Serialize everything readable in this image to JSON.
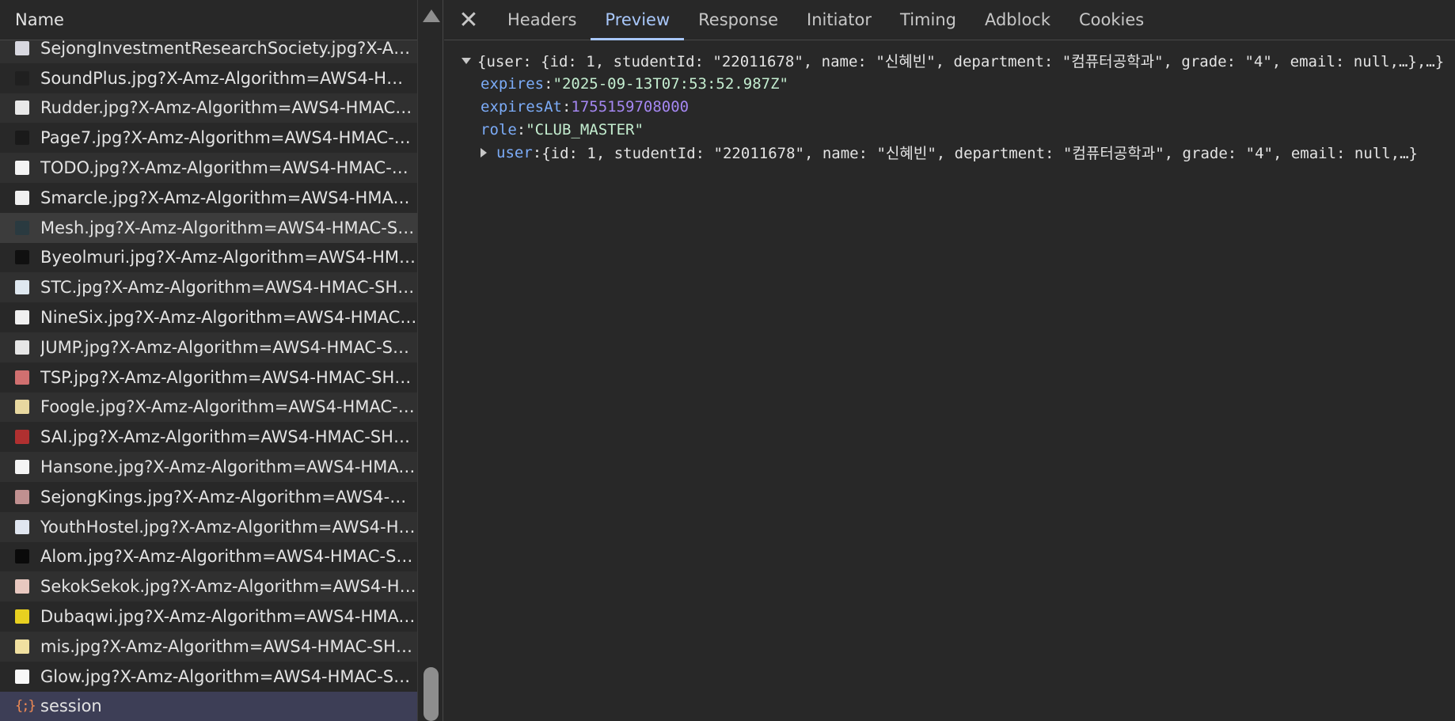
{
  "left_panel": {
    "header": "Name",
    "rows": [
      {
        "label": "SejongInvestmentResearchSociety.jpg?X-Amz-...",
        "thumb": "#d8d8e0",
        "state": "normal"
      },
      {
        "label": "SoundPlus.jpg?X-Amz-Algorithm=AWS4-HMA...",
        "thumb": "#202020",
        "state": "normal"
      },
      {
        "label": "Rudder.jpg?X-Amz-Algorithm=AWS4-HMAC-S...",
        "thumb": "#e8e8e8",
        "state": "normal"
      },
      {
        "label": "Page7.jpg?X-Amz-Algorithm=AWS4-HMAC-SH...",
        "thumb": "#1a1a1a",
        "state": "normal"
      },
      {
        "label": "TODO.jpg?X-Amz-Algorithm=AWS4-HMAC-SH...",
        "thumb": "#f4f4f4",
        "state": "normal"
      },
      {
        "label": "Smarcle.jpg?X-Amz-Algorithm=AWS4-HMAC-S...",
        "thumb": "#f0f0f0",
        "state": "normal"
      },
      {
        "label": "Mesh.jpg?X-Amz-Algorithm=AWS4-HMAC-SH...",
        "thumb": "#2a3a40",
        "state": "hover"
      },
      {
        "label": "Byeolmuri.jpg?X-Amz-Algorithm=AWS4-HMA...",
        "thumb": "#101010",
        "state": "normal"
      },
      {
        "label": "STC.jpg?X-Amz-Algorithm=AWS4-HMAC-SHA...",
        "thumb": "#dfe8f0",
        "state": "normal"
      },
      {
        "label": "NineSix.jpg?X-Amz-Algorithm=AWS4-HMAC-S...",
        "thumb": "#f0f0f0",
        "state": "normal"
      },
      {
        "label": "JUMP.jpg?X-Amz-Algorithm=AWS4-HMAC-SH...",
        "thumb": "#e6e6e6",
        "state": "normal"
      },
      {
        "label": "TSP.jpg?X-Amz-Algorithm=AWS4-HMAC-SHA2...",
        "thumb": "#d07070",
        "state": "normal"
      },
      {
        "label": "Foogle.jpg?X-Amz-Algorithm=AWS4-HMAC-S...",
        "thumb": "#e8d8a0",
        "state": "normal"
      },
      {
        "label": "SAI.jpg?X-Amz-Algorithm=AWS4-HMAC-SHA2...",
        "thumb": "#b03030",
        "state": "normal"
      },
      {
        "label": "Hansone.jpg?X-Amz-Algorithm=AWS4-HMAC-...",
        "thumb": "#f4f4f4",
        "state": "normal"
      },
      {
        "label": "SejongKings.jpg?X-Amz-Algorithm=AWS4-HM...",
        "thumb": "#c09090",
        "state": "normal"
      },
      {
        "label": "YouthHostel.jpg?X-Amz-Algorithm=AWS4-HM...",
        "thumb": "#e0e6f0",
        "state": "normal"
      },
      {
        "label": "Alom.jpg?X-Amz-Algorithm=AWS4-HMAC-SH...",
        "thumb": "#0a0a0a",
        "state": "normal"
      },
      {
        "label": "SekokSekok.jpg?X-Amz-Algorithm=AWS4-HM...",
        "thumb": "#e8c8c0",
        "state": "normal"
      },
      {
        "label": "Dubaqwi.jpg?X-Amz-Algorithm=AWS4-HMAC-...",
        "thumb": "#e8d020",
        "state": "normal"
      },
      {
        "label": "mis.jpg?X-Amz-Algorithm=AWS4-HMAC-SHA2...",
        "thumb": "#f0e0a0",
        "state": "normal"
      },
      {
        "label": "Glow.jpg?X-Amz-Algorithm=AWS4-HMAC-SH...",
        "thumb": "#f8f8f8",
        "state": "normal"
      },
      {
        "label": "session",
        "thumb": "json",
        "thumb_glyph": "{;}",
        "state": "selected"
      }
    ]
  },
  "tabs": {
    "close": "✕",
    "items": [
      "Headers",
      "Preview",
      "Response",
      "Initiator",
      "Timing",
      "Adblock",
      "Cookies"
    ],
    "active": "Preview"
  },
  "preview": {
    "summary": "{user: {id: 1, studentId: \"22011678\", name: \"신혜빈\", department: \"컴퓨터공학과\", grade: \"4\", email: null,…},…}",
    "expires_key": "expires",
    "expires_value": "\"2025-09-13T07:53:52.987Z\"",
    "expiresAt_key": "expiresAt",
    "expiresAt_value": "1755159708000",
    "role_key": "role",
    "role_value": "\"CLUB_MASTER\"",
    "user_key": "user",
    "user_value": "{id: 1, studentId: \"22011678\", name: \"신혜빈\", department: \"컴퓨터공학과\", grade: \"4\", email: null,…}"
  },
  "colors": {
    "background": "#282828",
    "accent": "#a8c7fa",
    "key": "#7cacf8",
    "string": "#c4eed0",
    "number": "#a587f2",
    "selected_row": "#3d3e56"
  }
}
